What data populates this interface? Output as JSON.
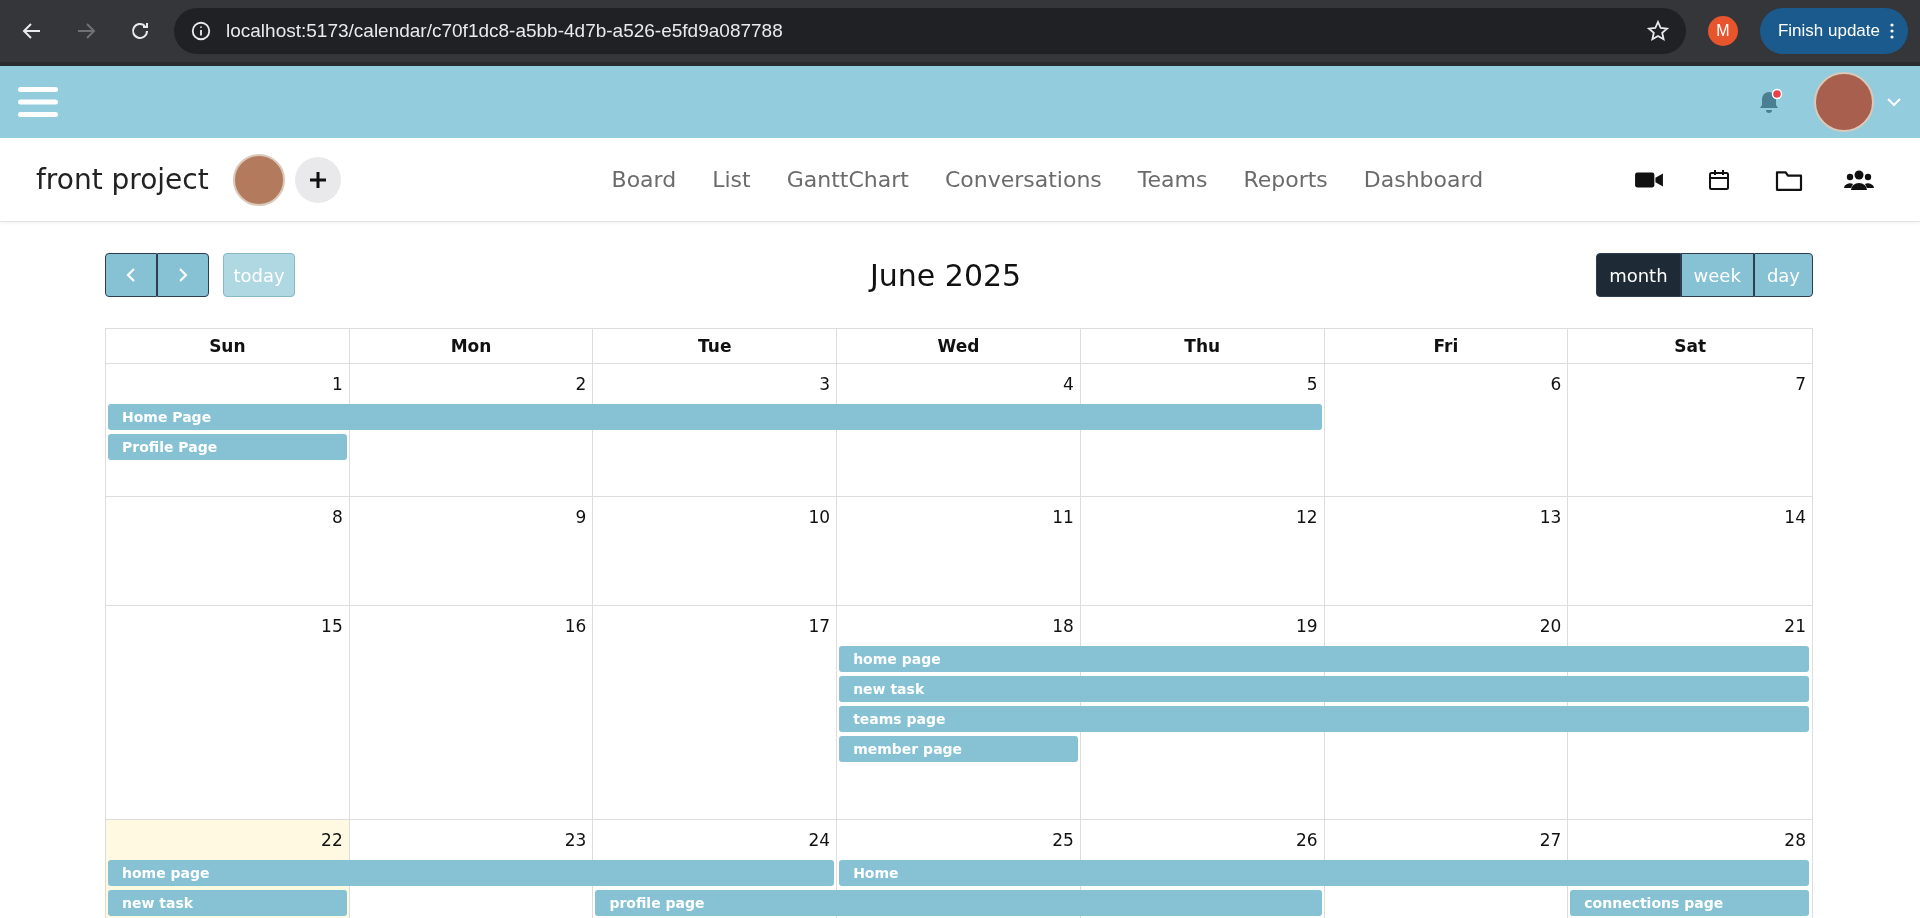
{
  "browser": {
    "url": "localhost:5173/calendar/c70f1dc8-a5bb-4d7b-a526-e5fd9a087788",
    "profile_initial": "M",
    "update_button": "Finish update",
    "forward_disabled": true
  },
  "app_bar": {
    "has_notification": true
  },
  "project": {
    "name": "front project",
    "nav": [
      {
        "label": "Board"
      },
      {
        "label": "List"
      },
      {
        "label": "GanttChart"
      },
      {
        "label": "Conversations"
      },
      {
        "label": "Teams"
      },
      {
        "label": "Reports"
      },
      {
        "label": "Dashboard"
      }
    ]
  },
  "toolbar": {
    "today": "today",
    "today_disabled": true,
    "title": "June 2025",
    "views": [
      {
        "label": "month",
        "selected": true
      },
      {
        "label": "week",
        "selected": false
      },
      {
        "label": "day",
        "selected": false
      }
    ]
  },
  "weekdays": [
    "Sun",
    "Mon",
    "Tue",
    "Wed",
    "Thu",
    "Fri",
    "Sat"
  ],
  "weeks": [
    {
      "days": [
        {
          "date": "1",
          "today": false
        },
        {
          "date": "2",
          "today": false
        },
        {
          "date": "3",
          "today": false
        },
        {
          "date": "4",
          "today": false
        },
        {
          "date": "5",
          "today": false
        },
        {
          "date": "6",
          "today": false
        },
        {
          "date": "7",
          "today": false
        }
      ],
      "lanes": [
        [
          {
            "kind": "start",
            "title": "Home Page"
          },
          {
            "kind": "continue"
          },
          {
            "kind": "continue"
          },
          {
            "kind": "continue"
          },
          {
            "kind": "continue"
          },
          {
            "kind": "empty"
          },
          {
            "kind": "empty"
          }
        ],
        [
          {
            "kind": "start",
            "title": "Profile Page"
          },
          {
            "kind": "empty"
          },
          {
            "kind": "empty"
          },
          {
            "kind": "empty"
          },
          {
            "kind": "empty"
          },
          {
            "kind": "empty"
          },
          {
            "kind": "empty"
          }
        ]
      ]
    },
    {
      "days": [
        {
          "date": "8",
          "today": false
        },
        {
          "date": "9",
          "today": false
        },
        {
          "date": "10",
          "today": false
        },
        {
          "date": "11",
          "today": false
        },
        {
          "date": "12",
          "today": false
        },
        {
          "date": "13",
          "today": false
        },
        {
          "date": "14",
          "today": false
        }
      ]
    },
    {
      "days": [
        {
          "date": "15",
          "today": false
        },
        {
          "date": "16",
          "today": false
        },
        {
          "date": "17",
          "today": false
        },
        {
          "date": "18",
          "today": false
        },
        {
          "date": "19",
          "today": false
        },
        {
          "date": "20",
          "today": false
        },
        {
          "date": "21",
          "today": false
        }
      ],
      "lanes": [
        [
          {
            "kind": "empty"
          },
          {
            "kind": "empty"
          },
          {
            "kind": "empty"
          },
          {
            "kind": "start",
            "title": "home page"
          },
          {
            "kind": "continue"
          },
          {
            "kind": "continue"
          },
          {
            "kind": "continue"
          }
        ],
        [
          {
            "kind": "empty"
          },
          {
            "kind": "empty"
          },
          {
            "kind": "empty"
          },
          {
            "kind": "start",
            "title": "new task"
          },
          {
            "kind": "continue"
          },
          {
            "kind": "continue"
          },
          {
            "kind": "continue"
          }
        ],
        [
          {
            "kind": "empty"
          },
          {
            "kind": "empty"
          },
          {
            "kind": "empty"
          },
          {
            "kind": "start",
            "title": "teams page"
          },
          {
            "kind": "continue"
          },
          {
            "kind": "continue"
          },
          {
            "kind": "continue"
          }
        ],
        [
          {
            "kind": "empty"
          },
          {
            "kind": "empty"
          },
          {
            "kind": "empty"
          },
          {
            "kind": "start",
            "title": "member page"
          },
          {
            "kind": "empty"
          },
          {
            "kind": "empty"
          },
          {
            "kind": "empty"
          }
        ]
      ]
    },
    {
      "days": [
        {
          "date": "22",
          "today": true
        },
        {
          "date": "23",
          "today": false
        },
        {
          "date": "24",
          "today": false
        },
        {
          "date": "25",
          "today": false
        },
        {
          "date": "26",
          "today": false
        },
        {
          "date": "27",
          "today": false
        },
        {
          "date": "28",
          "today": false
        }
      ],
      "lanes": [
        [
          {
            "kind": "start",
            "title": "home page"
          },
          {
            "kind": "continue"
          },
          {
            "kind": "continue"
          },
          {
            "kind": "start",
            "title": "Home"
          },
          {
            "kind": "continue"
          },
          {
            "kind": "continue"
          },
          {
            "kind": "continue"
          }
        ],
        [
          {
            "kind": "start",
            "title": "new task"
          },
          {
            "kind": "empty"
          },
          {
            "kind": "start",
            "title": "profile page"
          },
          {
            "kind": "continue"
          },
          {
            "kind": "continue"
          },
          {
            "kind": "empty"
          },
          {
            "kind": "start",
            "title": "connections page"
          }
        ]
      ]
    }
  ]
}
